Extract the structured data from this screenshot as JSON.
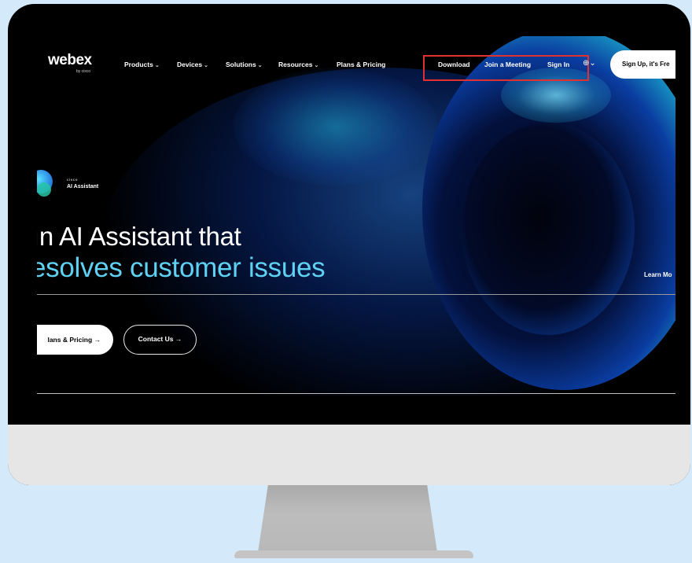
{
  "nav": {
    "logo": "webex",
    "logo_sub": "by cisco",
    "items": [
      {
        "label": "Products",
        "chevron": "⌄"
      },
      {
        "label": "Devices",
        "chevron": "⌄"
      },
      {
        "label": "Solutions",
        "chevron": "⌄"
      },
      {
        "label": "Resources",
        "chevron": "⌄"
      },
      {
        "label": "Plans & Pricing",
        "chevron": ""
      }
    ],
    "right_links": [
      "Download",
      "Join a Meeting",
      "Sign In"
    ],
    "globe_icon": "⊕⌄",
    "signup_label": "Sign Up, it's Fre"
  },
  "hero": {
    "badge_brand": "cisco",
    "badge_label": "AI Assistant",
    "title": "ın AI Assistant that",
    "subtitle": "esolves customer issues",
    "pricing_button": "lans & Pricing →",
    "contact_button": "Contact Us →",
    "learn_more": "Learn Mo"
  },
  "colors": {
    "page_background": "#d4e9f9",
    "accent_cyan": "#5fd2f3",
    "highlight_red": "#e03131"
  }
}
